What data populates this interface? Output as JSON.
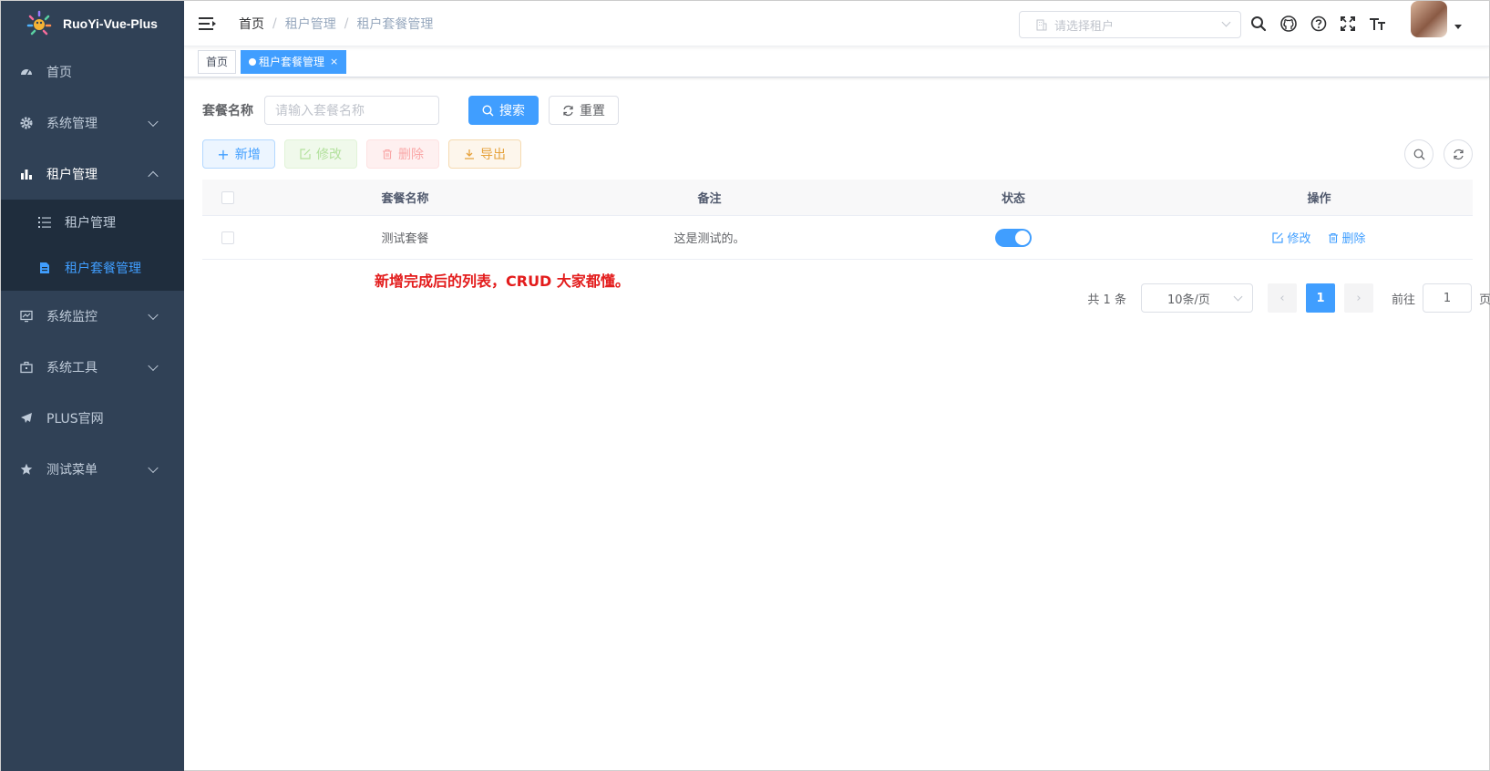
{
  "app": {
    "title": "RuoYi-Vue-Plus"
  },
  "sidebar": {
    "items": [
      {
        "label": "首页",
        "icon": "dashboard-icon"
      },
      {
        "label": "系统管理",
        "icon": "gear-icon"
      },
      {
        "label": "租户管理",
        "icon": "bar-chart-icon"
      },
      {
        "label": "系统监控",
        "icon": "monitor-icon"
      },
      {
        "label": "系统工具",
        "icon": "toolbox-icon"
      },
      {
        "label": "PLUS官网",
        "icon": "paper-plane-icon"
      },
      {
        "label": "测试菜单",
        "icon": "star-icon"
      }
    ],
    "sub_items": [
      {
        "label": "租户管理",
        "icon": "list-icon"
      },
      {
        "label": "租户套餐管理",
        "icon": "document-icon",
        "active": true
      }
    ]
  },
  "navbar": {
    "breadcrumb": [
      "首页",
      "租户管理",
      "租户套餐管理"
    ],
    "tenant_placeholder": "请选择租户"
  },
  "tags": [
    {
      "label": "首页"
    },
    {
      "label": "租户套餐管理",
      "active": true
    }
  ],
  "search": {
    "label": "套餐名称",
    "placeholder": "请输入套餐名称",
    "search_label": "搜索",
    "reset_label": "重置"
  },
  "toolbar": {
    "add": "新增",
    "edit": "修改",
    "delete": "删除",
    "export": "导出"
  },
  "table": {
    "headers": [
      "套餐名称",
      "备注",
      "状态",
      "操作"
    ],
    "rows": [
      {
        "name": "测试套餐",
        "remark": "这是测试的。",
        "status_on": true,
        "edit": "修改",
        "delete": "删除"
      }
    ]
  },
  "note": "新增完成后的列表，CRUD 大家都懂。",
  "pagination": {
    "total": "共 1 条",
    "page_size": "10条/页",
    "current": "1",
    "goto_label": "前往",
    "goto_value": "1",
    "page_suffix": "页"
  },
  "colors": {
    "primary": "#409eff",
    "sidebar_bg": "#304156",
    "note": "#e31c1c"
  }
}
